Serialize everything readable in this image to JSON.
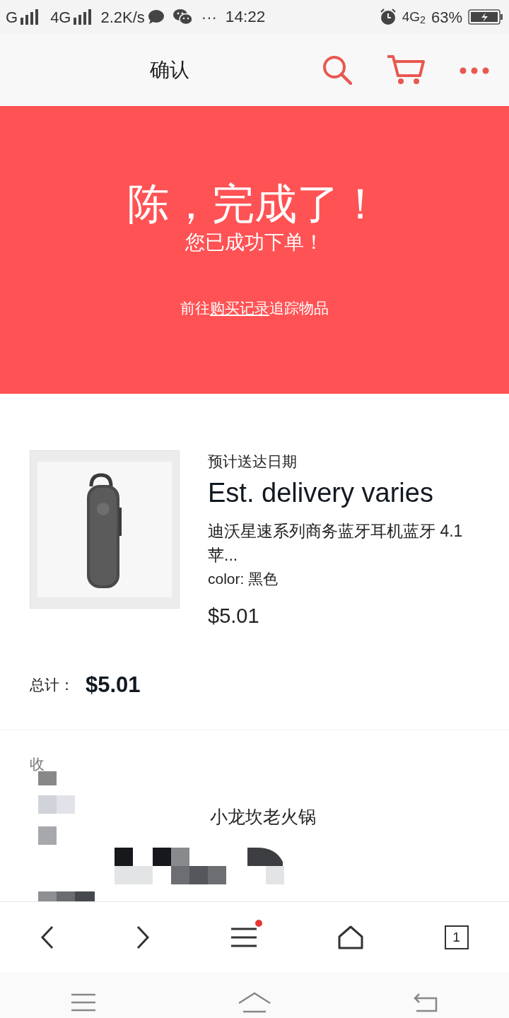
{
  "status_bar": {
    "carrier_1": "G",
    "carrier_2": "4G",
    "speed": "2.2K/s",
    "more": "···",
    "time": "14:22",
    "network": "4G",
    "network_sub": "2",
    "battery": "63%"
  },
  "header": {
    "title": "确认"
  },
  "banner": {
    "title": "陈，完成了！",
    "subtitle": "您已成功下单！",
    "track": {
      "before": "前往",
      "link": "购买记录",
      "after": "追踪物品"
    }
  },
  "order": {
    "delivery_label": "预计送达日期",
    "delivery": "Est. delivery varies",
    "product": "迪沃星速系列商务蓝牙耳机蓝牙 4.1 苹...",
    "variant": "color: 黑色",
    "price": "$5.01",
    "total_label": "总计：",
    "total": "$5.01"
  },
  "address": {
    "label": "收",
    "line": "小龙坎老火锅"
  },
  "browser_bar": {
    "menu_badge": true,
    "tabs": "1"
  }
}
